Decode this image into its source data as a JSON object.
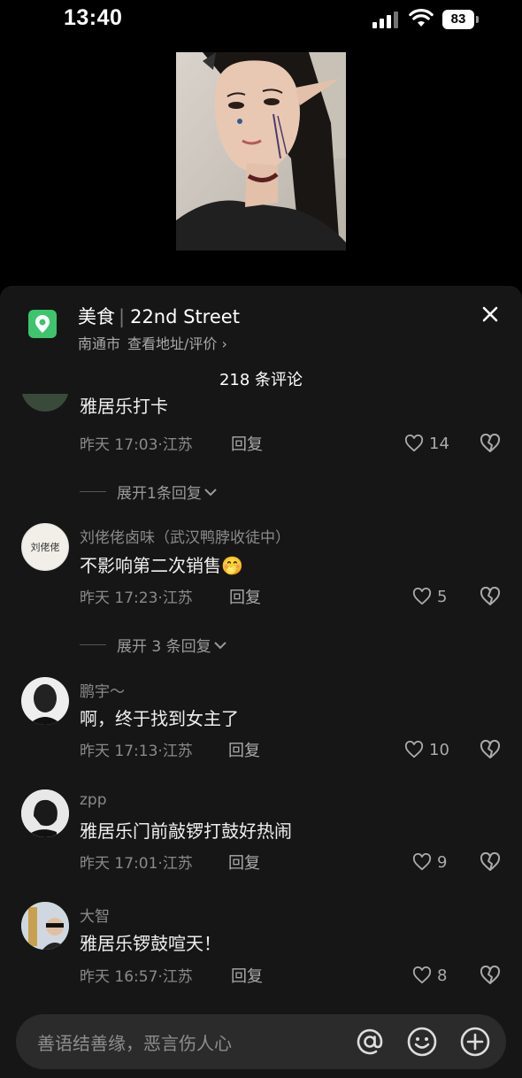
{
  "status_bar": {
    "time": "13:40",
    "battery": "83"
  },
  "location": {
    "category": "美食",
    "name": "22nd Street",
    "city": "南通市",
    "link": "查看地址/评价 ›"
  },
  "comments_header": {
    "count_label": "218 条评论"
  },
  "comments": [
    {
      "text": "雅居乐打卡",
      "time": "昨天 17:03",
      "region": "江苏",
      "reply": "回复",
      "likes": "14"
    },
    {
      "expand": "展开1条回复",
      "name": "刘佬佬卤味（武汉鸭脖收徒中）",
      "avatar_text": "刘佬佬",
      "text": "不影响第二次销售🤭",
      "time": "昨天 17:23",
      "region": "江苏",
      "reply": "回复",
      "likes": "5"
    },
    {
      "expand": "展开 3 条回复",
      "name": "鹏宇～",
      "text": "啊，终于找到女主了",
      "time": "昨天 17:13",
      "region": "江苏",
      "reply": "回复",
      "likes": "10"
    },
    {
      "name": "zpp",
      "text": "雅居乐门前敲锣打鼓好热闹",
      "time": "昨天 17:01",
      "region": "江苏",
      "reply": "回复",
      "likes": "9"
    },
    {
      "name": "大智",
      "text": "雅居乐锣鼓喧天！",
      "time": "昨天 16:57",
      "region": "江苏",
      "reply": "回复",
      "likes": "8"
    }
  ],
  "input": {
    "placeholder": "善语结善缘，恶言伤人心"
  },
  "icons": {
    "map": "map-pin-icon",
    "close": "close-icon",
    "like": "heart-outline-icon",
    "dislike": "broken-heart-icon",
    "mention": "at-sign-icon",
    "emoji": "smiley-icon",
    "add": "plus-circle-icon"
  },
  "colors": {
    "sheet_bg": "#161616",
    "map_green": "#3ec46d",
    "input_bg": "#2b2b2b"
  }
}
